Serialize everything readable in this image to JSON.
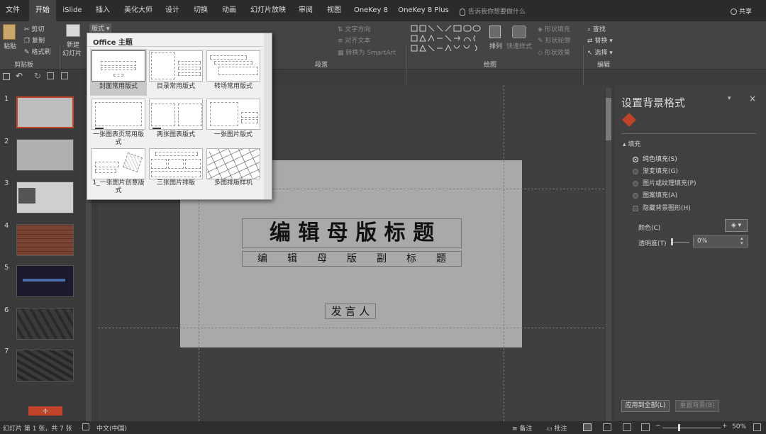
{
  "tabs": [
    {
      "label": "文件"
    },
    {
      "label": "开始"
    },
    {
      "label": "iSlide"
    },
    {
      "label": "插入"
    },
    {
      "label": "美化大师"
    },
    {
      "label": "设计"
    },
    {
      "label": "切换"
    },
    {
      "label": "动画"
    },
    {
      "label": "幻灯片放映"
    },
    {
      "label": "审阅"
    },
    {
      "label": "视图"
    },
    {
      "label": "OneKey 8"
    },
    {
      "label": "OneKey 8 Plus"
    }
  ],
  "tellme": "告诉我你想要做什么",
  "share": "共享",
  "ribbon": {
    "paste": "粘贴",
    "cut": "剪切",
    "copy": "复制",
    "format_painter": "格式刷",
    "new_slide": "新建",
    "new_slide2": "幻灯片",
    "layout": "版式",
    "text_direction": "文字方向",
    "align_text": "对齐文本",
    "smartart": "转换为 SmartArt",
    "arrange": "排列",
    "quick_styles": "快速样式",
    "shape_fill": "形状填充",
    "shape_outline": "形状轮廓",
    "shape_effects": "形状效果",
    "find": "查找",
    "replace": "替换",
    "select": "选择",
    "groups": {
      "clipboard": "剪贴板",
      "paragraph": "段落",
      "drawing": "绘图",
      "editing": "编辑"
    }
  },
  "dropdown": {
    "header": "Office 主题",
    "layouts": [
      {
        "label": "封面常用版式"
      },
      {
        "label": "目录常用版式"
      },
      {
        "label": "转场常用版式"
      },
      {
        "label": "一张图表页常用版式"
      },
      {
        "label": "两张图表版式"
      },
      {
        "label": "一张图片版式"
      },
      {
        "label": "1_一张图片创意版式"
      },
      {
        "label": "三张图片排版"
      },
      {
        "label": "多图排版样机"
      }
    ]
  },
  "slides": [
    {
      "num": "1"
    },
    {
      "num": "2"
    },
    {
      "num": "3"
    },
    {
      "num": "4"
    },
    {
      "num": "5"
    },
    {
      "num": "6"
    },
    {
      "num": "7"
    }
  ],
  "add_slide": "+",
  "slide": {
    "title": "编 辑 母 版 标 题",
    "subtitle": "编　　辑　　母　　版　　副　　标　　题",
    "presenter": "发 言 人"
  },
  "pane": {
    "title": "设置背景格式",
    "section_fill": "填充",
    "options": [
      {
        "label": "纯色填充(S)",
        "selected": true
      },
      {
        "label": "渐变填充(G)",
        "selected": false
      },
      {
        "label": "图片或纹理填充(P)",
        "selected": false
      },
      {
        "label": "图案填充(A)",
        "selected": false
      }
    ],
    "hide_bg": "隐藏背景图形(H)",
    "color_label": "颜色(C)",
    "transparency_label": "透明度(T)",
    "transparency_value": "0%",
    "apply_all": "应用到全部(L)",
    "reset": "重置背景(B)"
  },
  "status": {
    "slide_info": "幻灯片 第 1 张，共 7 张",
    "language": "中文(中国)",
    "notes": "备注",
    "comments": "批注",
    "zoom": "50%"
  }
}
